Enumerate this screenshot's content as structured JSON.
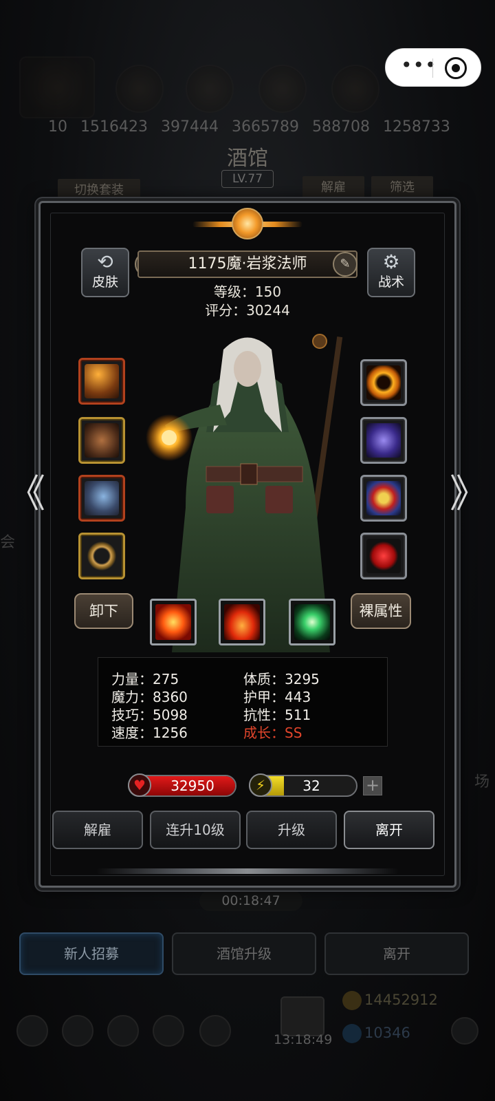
{
  "capsule": {
    "more_glyph": "•••",
    "close_glyph": "◉"
  },
  "background": {
    "resources": [
      "10",
      "1516423",
      "397444",
      "3665789",
      "588708",
      "1258733"
    ],
    "tavern_title": "酒馆",
    "tavern_level": "LV.77",
    "switch_outfit": "切换套装",
    "dismiss": "解雇",
    "filter": "筛选",
    "side_left_char": "会",
    "side_right_char": "场",
    "timer": "00:18:47",
    "tabs": [
      "新人招募",
      "酒馆升级",
      "离开"
    ],
    "gold": "14452912",
    "gems": "10346",
    "bottom_time": "13:18:49"
  },
  "hero": {
    "name": "1175魔·岩浆法师",
    "level_line": "等级：150",
    "score_line": "评分：30244",
    "skin_button": "皮肤",
    "tactics_button": "战术",
    "unequip_button": "卸下",
    "naked_attr_button": "裸属性"
  },
  "equipment_left": [
    {
      "icon": "staff-icon",
      "rarity": "red"
    },
    {
      "icon": "armor-icon",
      "rarity": "gold"
    },
    {
      "icon": "dragon-helm-icon",
      "rarity": "red"
    },
    {
      "icon": "ring-icon",
      "rarity": "gold"
    }
  ],
  "equipment_right": [
    {
      "icon": "fire-wheel-icon",
      "rarity": "gray"
    },
    {
      "icon": "cosmic-gem-icon",
      "rarity": "gray"
    },
    {
      "icon": "emblem-icon",
      "rarity": "gray"
    },
    {
      "icon": "red-stone-icon",
      "rarity": "gray"
    }
  ],
  "skills": [
    {
      "icon": "explosion-icon"
    },
    {
      "icon": "flame-icon"
    },
    {
      "icon": "green-crystal-icon"
    }
  ],
  "stats": {
    "strength": "力量：275",
    "magic": "魔力：8360",
    "skill": "技巧：5098",
    "speed": "速度：1256",
    "constitution": "体质：3295",
    "armor": "护甲：443",
    "resistance": "抗性：511",
    "growth": "成长：SS"
  },
  "hp": {
    "value": "32950",
    "fill_fraction": 1.0
  },
  "energy": {
    "value": "32",
    "fill_fraction": 0.32,
    "plus": "+"
  },
  "actions": {
    "dismiss": "解雇",
    "level_up_10": "连升10级",
    "level_up": "升级",
    "leave": "离开"
  },
  "nav": {
    "prev": "《",
    "next": "》"
  },
  "colors": {
    "hp": "#e11a1a",
    "energy": "#f2dd2a",
    "growth": "#e2452b"
  }
}
